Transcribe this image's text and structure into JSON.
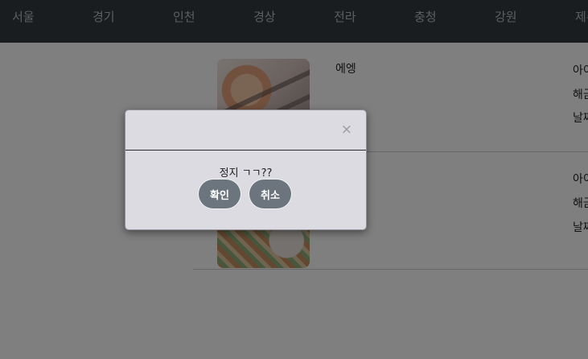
{
  "nav": {
    "regions": [
      "서울",
      "경기",
      "인천",
      "경상",
      "전라",
      "충청",
      "강원",
      "제주"
    ]
  },
  "cards": [
    {
      "name": "에엥",
      "meta": [
        "아이디",
        "해금",
        "날짜"
      ]
    },
    {
      "name": "",
      "meta": [
        "아이디",
        "해금",
        "날짜"
      ]
    }
  ],
  "modal": {
    "close_symbol": "×",
    "message": "정지 ㄱㄱ??",
    "confirm_label": "확인",
    "cancel_label": "취소"
  },
  "colors": {
    "navbar": "#343a40",
    "modal_background": "#dcdbe2",
    "button": "#6c757d"
  }
}
